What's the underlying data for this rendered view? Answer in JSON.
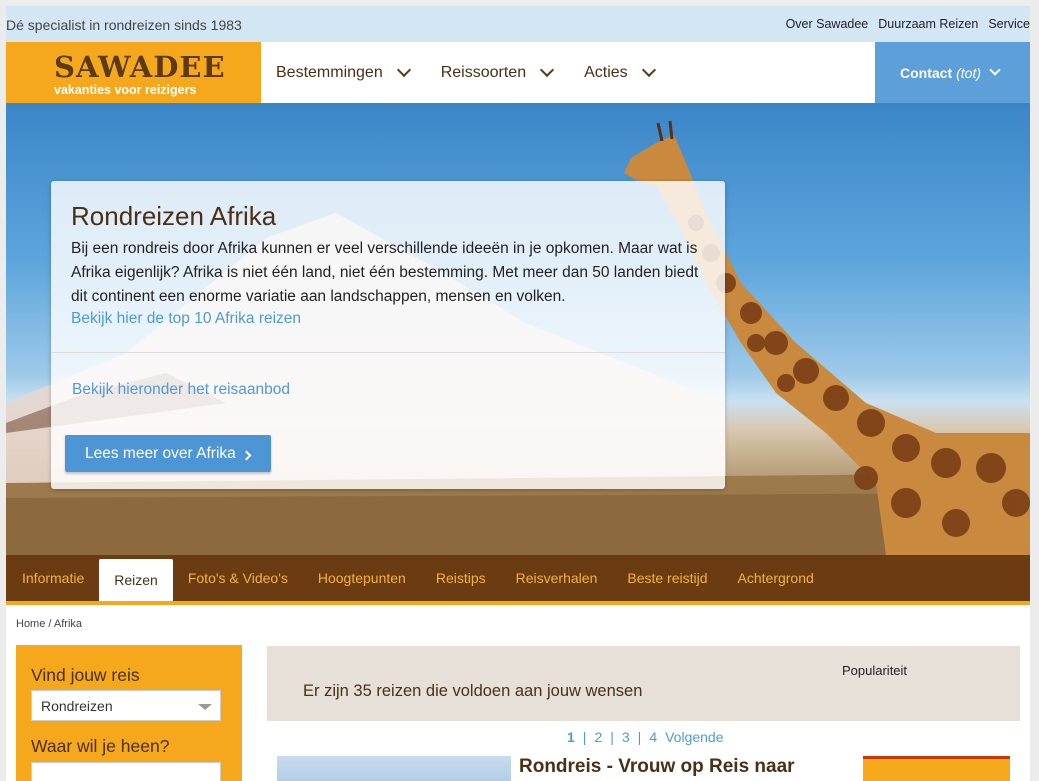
{
  "topbar": {
    "tagline": "Dé specialist in rondreizen sinds 1983",
    "links": [
      "Over Sawadee",
      "Duurzaam Reizen",
      "Service"
    ]
  },
  "header": {
    "logo_main": "SAWADEE",
    "logo_sub": "vakanties voor reizigers",
    "nav": [
      "Bestemmingen",
      "Reissoorten",
      "Acties"
    ],
    "contact_label": "Contact",
    "contact_tot": "(tot)"
  },
  "hero": {
    "title": "Rondreizen Afrika",
    "text": "Bij een rondreis door Afrika kunnen er veel verschillende ideeën in je opkomen. Maar wat is Afrika eigenlijk? Afrika is niet één land, niet één bestemming. Met meer dan 50 landen biedt dit continent een enorme variatie aan landschappen, mensen en volken.",
    "top10_link": "Bekijk hier de top 10 Afrika reizen",
    "offer_link": "Bekijk hieronder het reisaanbod",
    "more_button": "Lees meer over Afrika"
  },
  "tabs": [
    "Informatie",
    "Reizen",
    "Foto's & Video's",
    "Hoogtepunten",
    "Reistips",
    "Reisverhalen",
    "Beste reistijd",
    "Achtergrond"
  ],
  "active_tab": "Reizen",
  "breadcrumb": "Home / Afrika",
  "sidebar": {
    "title": "Vind jouw reis",
    "type_value": "Rondreizen",
    "where_label": "Waar wil je heen?"
  },
  "results": {
    "count_text": "Er zijn 35 reizen die voldoen aan jouw wensen",
    "sort_label": "Populariteit",
    "pages": [
      "1",
      "2",
      "3",
      "4"
    ],
    "next_label": "Volgende"
  },
  "card": {
    "title": "Rondreis - Vrouw op Reis naar"
  },
  "colors": {
    "brand_orange": "#f6a81d",
    "brand_brown": "#6b3b11",
    "link_blue": "#4d9bd7",
    "contact_blue": "#5d9fd9"
  }
}
